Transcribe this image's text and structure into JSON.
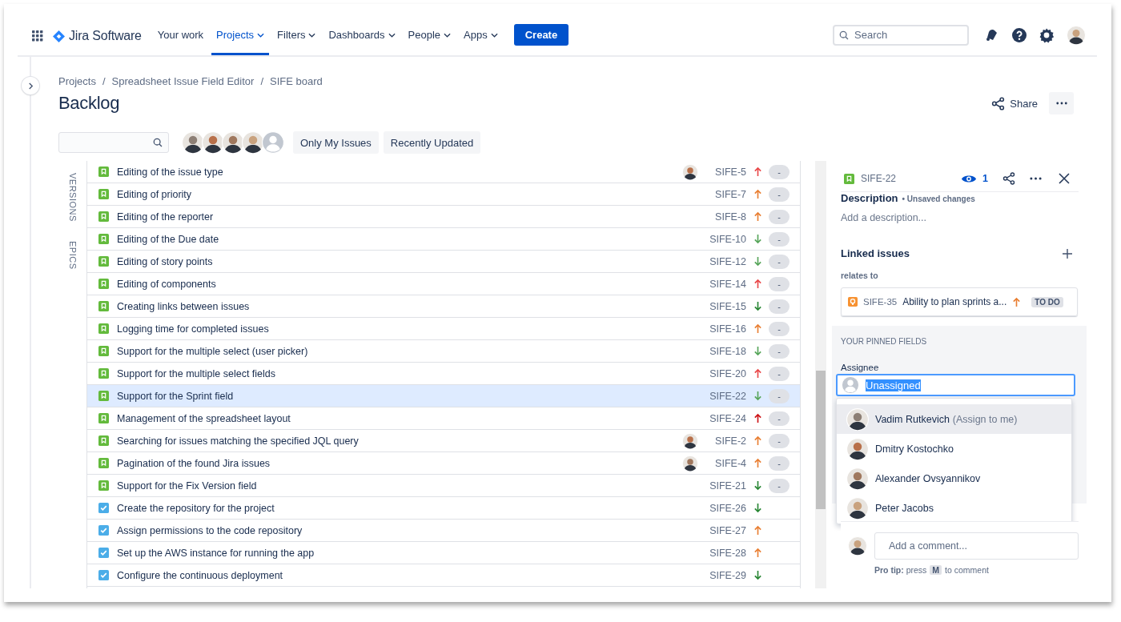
{
  "nav": {
    "product": "Jira Software",
    "items": [
      {
        "label": "Your work",
        "dropdown": false,
        "selected": false
      },
      {
        "label": "Projects",
        "dropdown": true,
        "selected": true
      },
      {
        "label": "Filters",
        "dropdown": true,
        "selected": false
      },
      {
        "label": "Dashboards",
        "dropdown": true,
        "selected": false
      },
      {
        "label": "People",
        "dropdown": true,
        "selected": false
      },
      {
        "label": "Apps",
        "dropdown": true,
        "selected": false
      }
    ],
    "create": "Create",
    "search": {
      "placeholder": "Search"
    }
  },
  "breadcrumbs": [
    {
      "label": "Projects",
      "separator": "/"
    },
    {
      "label": "Spreadsheet Issue Field Editor",
      "separator": "/"
    },
    {
      "label": "SIFE board"
    }
  ],
  "page": {
    "title": "Backlog",
    "share": "Share"
  },
  "toolbar": {
    "avatars": [
      {
        "kind": "photo"
      },
      {
        "kind": "photo"
      },
      {
        "kind": "photo"
      },
      {
        "kind": "photo"
      },
      {
        "kind": "placeholder"
      }
    ],
    "quick_filters": [
      "Only My Issues",
      "Recently Updated"
    ]
  },
  "side_tabs": [
    "VERSIONS",
    "EPICS"
  ],
  "issues": [
    {
      "kind": "story",
      "summary": "Editing of the issue type",
      "key": "SIFE-5",
      "priority": {
        "kind": "up",
        "color": "#e9494a"
      },
      "avatar": true,
      "status": "-",
      "selected": false
    },
    {
      "kind": "story",
      "summary": "Editing of priority",
      "key": "SIFE-7",
      "priority": {
        "kind": "up",
        "color": "#e97f33"
      },
      "avatar": false,
      "status": "-",
      "selected": false
    },
    {
      "kind": "story",
      "summary": "Editing of the reporter",
      "key": "SIFE-8",
      "priority": {
        "kind": "up",
        "color": "#e97f33"
      },
      "avatar": false,
      "status": "-",
      "selected": false
    },
    {
      "kind": "story",
      "summary": "Editing of the Due date",
      "key": "SIFE-10",
      "priority": {
        "kind": "down",
        "color": "#57a55a"
      },
      "avatar": false,
      "status": "-",
      "selected": false
    },
    {
      "kind": "story",
      "summary": "Editing of story points",
      "key": "SIFE-12",
      "priority": {
        "kind": "down",
        "color": "#57a55a"
      },
      "avatar": false,
      "status": "-",
      "selected": false
    },
    {
      "kind": "story",
      "summary": "Editing of components",
      "key": "SIFE-14",
      "priority": {
        "kind": "up",
        "color": "#e9494a"
      },
      "avatar": false,
      "status": "-",
      "selected": false
    },
    {
      "kind": "story",
      "summary": "Creating links between issues",
      "key": "SIFE-15",
      "priority": {
        "kind": "down",
        "color": "#2a8735"
      },
      "avatar": false,
      "status": "-",
      "selected": false
    },
    {
      "kind": "story",
      "summary": "Logging time for completed issues",
      "key": "SIFE-16",
      "priority": {
        "kind": "up",
        "color": "#e97f33"
      },
      "avatar": false,
      "status": "-",
      "selected": false
    },
    {
      "kind": "story",
      "summary": "Support for the multiple select (user picker)",
      "key": "SIFE-18",
      "priority": {
        "kind": "down",
        "color": "#57a55a"
      },
      "avatar": false,
      "status": "-",
      "selected": false
    },
    {
      "kind": "story",
      "summary": "Support for the multiple select fields",
      "key": "SIFE-20",
      "priority": {
        "kind": "up",
        "color": "#e9494a"
      },
      "avatar": false,
      "status": "-",
      "selected": false
    },
    {
      "kind": "story",
      "summary": "Support for the Sprint field",
      "key": "SIFE-22",
      "priority": {
        "kind": "down",
        "color": "#57a55a"
      },
      "avatar": false,
      "status": "-",
      "selected": true
    },
    {
      "kind": "story",
      "summary": "Management of the spreadsheet layout",
      "key": "SIFE-24",
      "priority": {
        "kind": "up",
        "color": "#cd1317"
      },
      "avatar": false,
      "status": "-",
      "selected": false
    },
    {
      "kind": "story",
      "summary": "Searching for issues matching the specified JQL query",
      "key": "SIFE-2",
      "priority": {
        "kind": "up",
        "color": "#e97f33"
      },
      "avatar": true,
      "status": "-",
      "selected": false
    },
    {
      "kind": "story",
      "summary": "Pagination of the found Jira issues",
      "key": "SIFE-4",
      "priority": {
        "kind": "up",
        "color": "#e97f33"
      },
      "avatar": true,
      "status": "-",
      "selected": false
    },
    {
      "kind": "story",
      "summary": "Support for the Fix Version field",
      "key": "SIFE-21",
      "priority": {
        "kind": "down",
        "color": "#2a8735"
      },
      "avatar": false,
      "status": "-",
      "selected": false
    },
    {
      "kind": "task",
      "summary": "Create the repository for the project",
      "key": "SIFE-26",
      "priority": {
        "kind": "down",
        "color": "#2a8735"
      },
      "avatar": false,
      "selected": false
    },
    {
      "kind": "task",
      "summary": "Assign permissions to the code repository",
      "key": "SIFE-27",
      "priority": {
        "kind": "up",
        "color": "#e97f33"
      },
      "avatar": false,
      "selected": false
    },
    {
      "kind": "task",
      "summary": "Set up the AWS instance for running the app",
      "key": "SIFE-28",
      "priority": {
        "kind": "up",
        "color": "#e97f33"
      },
      "avatar": false,
      "selected": false
    },
    {
      "kind": "task",
      "summary": "Configure the continuous deployment",
      "key": "SIFE-29",
      "priority": {
        "kind": "down",
        "color": "#2a8735"
      },
      "avatar": false,
      "selected": false
    }
  ],
  "detail": {
    "kind": "story",
    "key": "SIFE-22",
    "watchers": "1",
    "description": {
      "label": "Description",
      "note": "• Unsaved changes",
      "placeholder": "Add a description..."
    },
    "linked": {
      "label": "Linked issues",
      "relation": "relates to",
      "issue": {
        "kind": "idea",
        "key": "SIFE-35",
        "summary": "Ability to plan sprints a...",
        "priority": {
          "kind": "up",
          "color": "#e97f33"
        },
        "status": "TO DO"
      }
    },
    "pinned": {
      "heading": "YOUR PINNED FIELDS",
      "label": "Assignee",
      "value": "Unassigned",
      "text_selected": true,
      "options": [
        {
          "name": "Vadim Rutkevich",
          "note": "(Assign to me)",
          "selected": true
        },
        {
          "name": "Dmitry Kostochko",
          "selected": false
        },
        {
          "name": "Alexander Ovsyannikov",
          "selected": false
        },
        {
          "name": "Peter Jacobs",
          "selected": false
        }
      ]
    },
    "comment": {
      "placeholder": "Add a comment...",
      "tip_label": "**Pro tip:** press",
      "tip_key": "M",
      "tip_text": "to comment"
    }
  }
}
